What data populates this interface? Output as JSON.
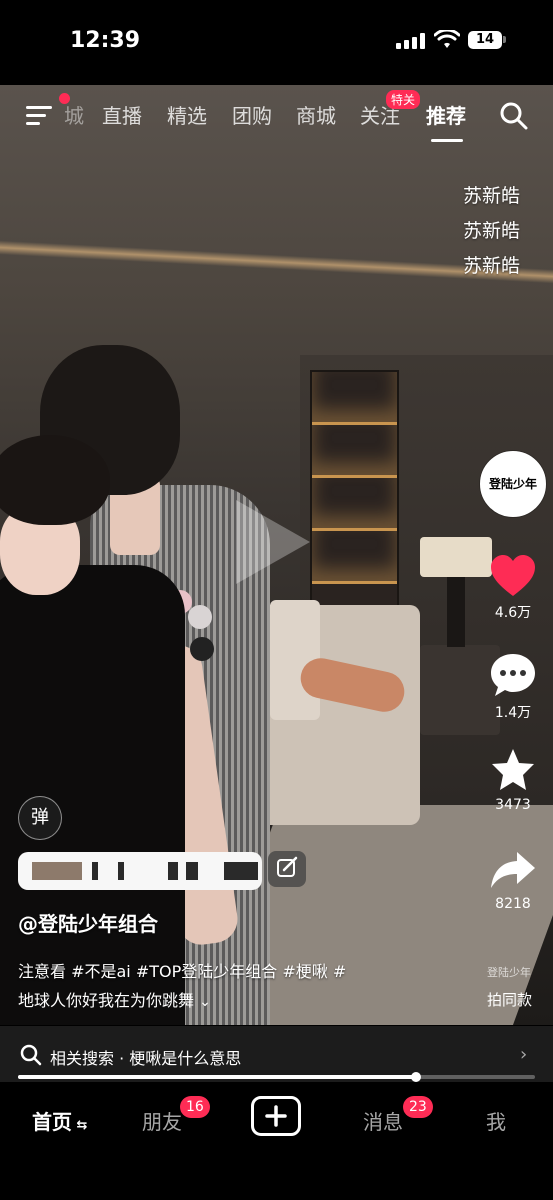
{
  "status_bar": {
    "time": "12:39",
    "battery": "14"
  },
  "top_nav": {
    "tabs": [
      {
        "label": "城"
      },
      {
        "label": "直播"
      },
      {
        "label": "精选"
      },
      {
        "label": "团购"
      },
      {
        "label": "商城"
      },
      {
        "label": "关注",
        "badge": "特关"
      },
      {
        "label": "推荐",
        "active": true
      }
    ]
  },
  "overlay_names": [
    "苏新皓",
    "苏新皓",
    "苏新皓"
  ],
  "actions": {
    "avatar_text": "登陆少年",
    "likes": "4.6万",
    "comments": "1.4万",
    "favorites": "3473",
    "shares": "8218"
  },
  "video_info": {
    "danmaku_label": "弹",
    "author": "@登陆少年组合",
    "description_line1": "注意看 #不是ai #TOP登陆少年组合 #梗啾 #",
    "description_line2": "地球人你好我在为你跳舞",
    "same_shot": "拍同款",
    "watermark": "登陆少年"
  },
  "related_search": {
    "text": "相关搜索 · 梗啾是什么意思",
    "progress": 0.77
  },
  "bottom_tabs": [
    {
      "label": "首页",
      "active": true
    },
    {
      "label": "朋友",
      "badge": "16"
    },
    {
      "label": "",
      "type": "plus"
    },
    {
      "label": "消息",
      "badge": "23"
    },
    {
      "label": "我"
    }
  ],
  "colors": {
    "accent": "#fe2c55",
    "background": "#000000"
  }
}
